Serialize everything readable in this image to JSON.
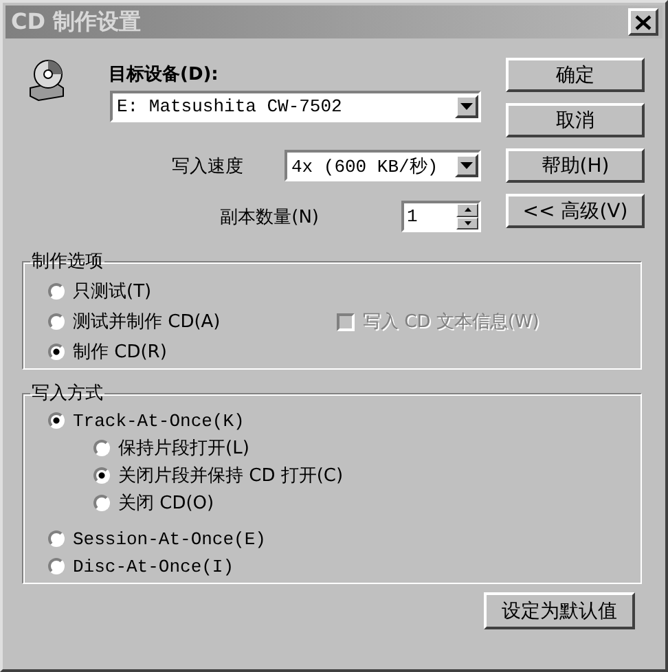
{
  "window": {
    "title": "CD 制作设置"
  },
  "target_device": {
    "label": "目标设备(D):",
    "value": "E: Matsushita CW-7502"
  },
  "write_speed": {
    "label": "写入速度",
    "value": "4x (600 KB/秒)"
  },
  "copies": {
    "label": "副本数量(N)",
    "value": "1"
  },
  "buttons": [
    "确定",
    "取消",
    "帮助(H)",
    "<< 高级(V)"
  ],
  "options_group": {
    "title": "制作选项",
    "options": [
      {
        "label": "只测试(T)",
        "selected": false
      },
      {
        "label": "测试并制作 CD(A)",
        "selected": false
      },
      {
        "label": "制作 CD(R)",
        "selected": true
      }
    ],
    "cd_text": {
      "label": "写入 CD 文本信息(W)",
      "checked": false,
      "disabled": true
    }
  },
  "write_method": {
    "title": "写入方式",
    "options": [
      {
        "label": "Track-At-Once(K)",
        "selected": true,
        "children": [
          {
            "label": "保持片段打开(L)",
            "selected": false
          },
          {
            "label": "关闭片段并保持 CD 打开(C)",
            "selected": true
          },
          {
            "label": "关闭 CD(O)",
            "selected": false
          }
        ]
      },
      {
        "label": "Session-At-Once(E)",
        "selected": false
      },
      {
        "label": "Disc-At-Once(I)",
        "selected": false
      }
    ]
  },
  "default_button": "设定为默认值"
}
